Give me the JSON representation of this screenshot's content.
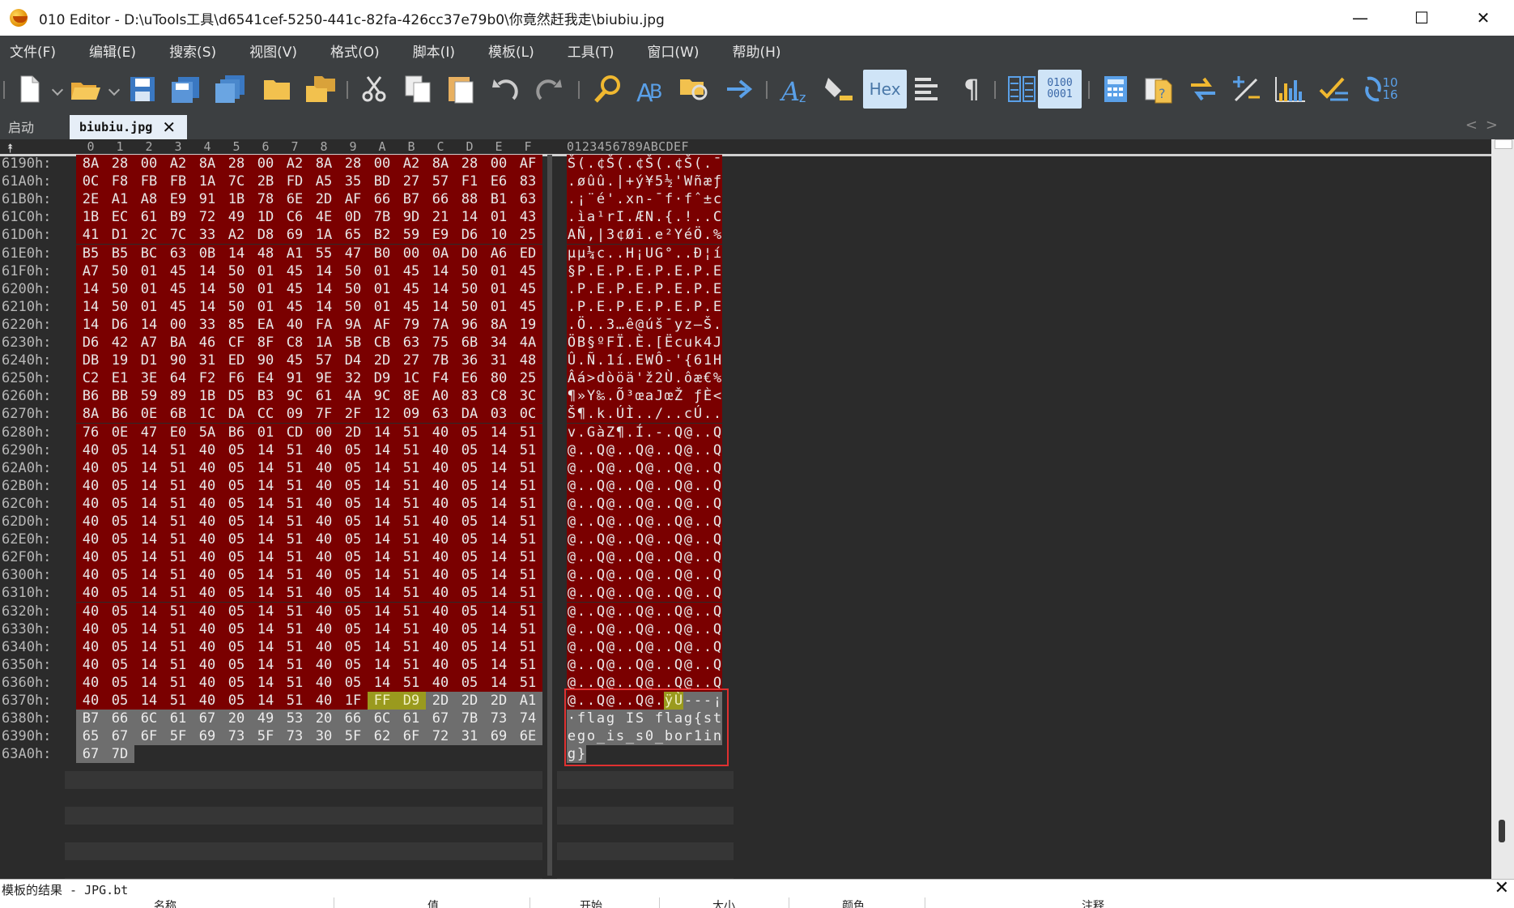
{
  "window": {
    "title": "010 Editor - D:\\uTools工具\\d6541cef-5250-441c-82fa-426cc37e79b0\\你竟然赶我走\\biubiu.jpg",
    "minimize": "—",
    "maximize": "☐",
    "close": "✕"
  },
  "menu": [
    "文件(F)",
    "编辑(E)",
    "搜索(S)",
    "视图(V)",
    "格式(O)",
    "脚本(I)",
    "模板(L)",
    "工具(T)",
    "窗口(W)",
    "帮助(H)"
  ],
  "toolbar": {
    "hex_label": "Hex",
    "binary_label": "0100\n0001",
    "base_label": "10\n16"
  },
  "tabs": {
    "start": "启动",
    "file": "biubiu.jpg",
    "close": "✕",
    "nav": "<>"
  },
  "hex_header": [
    "0",
    "1",
    "2",
    "3",
    "4",
    "5",
    "6",
    "7",
    "8",
    "9",
    "A",
    "B",
    "C",
    "D",
    "E",
    "F"
  ],
  "ascii_header": "0123456789ABCDEF",
  "rows": [
    {
      "addr": "6190h:",
      "bytes": [
        "8A",
        "28",
        "00",
        "A2",
        "8A",
        "28",
        "00",
        "A2",
        "8A",
        "28",
        "00",
        "A2",
        "8A",
        "28",
        "00",
        "AF"
      ],
      "ascii": "Š(.¢Š(.¢Š(.¢Š(.¯",
      "style": "rrrrrrrrrrrrrrrr"
    },
    {
      "addr": "61A0h:",
      "bytes": [
        "0C",
        "F8",
        "FB",
        "FB",
        "1A",
        "7C",
        "2B",
        "FD",
        "A5",
        "35",
        "BD",
        "27",
        "57",
        "F1",
        "E6",
        "83"
      ],
      "ascii": ".øûû.|+ý¥5½'Wñæƒ",
      "style": "rrrrrrrrrrrrrrrr"
    },
    {
      "addr": "61B0h:",
      "bytes": [
        "2E",
        "A1",
        "A8",
        "E9",
        "91",
        "1B",
        "78",
        "6E",
        "2D",
        "AF",
        "66",
        "B7",
        "66",
        "88",
        "B1",
        "63"
      ],
      "ascii": ".¡¨é'.xn-¯f·fˆ±c",
      "style": "rrrrrrrrrrrrrrrr"
    },
    {
      "addr": "61C0h:",
      "bytes": [
        "1B",
        "EC",
        "61",
        "B9",
        "72",
        "49",
        "1D",
        "C6",
        "4E",
        "0D",
        "7B",
        "9D",
        "21",
        "14",
        "01",
        "43"
      ],
      "ascii": ".ìa¹rI.ÆN.{.!..C",
      "style": "rrrrrrrrrrrrrrrr"
    },
    {
      "addr": "61D0h:",
      "bytes": [
        "41",
        "D1",
        "2C",
        "7C",
        "33",
        "A2",
        "D8",
        "69",
        "1A",
        "65",
        "B2",
        "59",
        "E9",
        "D6",
        "10",
        "25"
      ],
      "ascii": "AÑ,|3¢Øi.e²YéÖ.%",
      "style": "rrrrrrrrrrrrrrrr"
    },
    {
      "addr": "61E0h:",
      "bytes": [
        "B5",
        "B5",
        "BC",
        "63",
        "0B",
        "14",
        "48",
        "A1",
        "55",
        "47",
        "B0",
        "00",
        "0A",
        "D0",
        "A6",
        "ED"
      ],
      "ascii": "µµ¼c..H¡UG°..Ð¦í",
      "style": "rrrrrrrrrrrrrrrr"
    },
    {
      "addr": "61F0h:",
      "bytes": [
        "A7",
        "50",
        "01",
        "45",
        "14",
        "50",
        "01",
        "45",
        "14",
        "50",
        "01",
        "45",
        "14",
        "50",
        "01",
        "45"
      ],
      "ascii": "§P.E.P.E.P.E.P.E",
      "style": "rrrrrrrrrrrrrrrr"
    },
    {
      "addr": "6200h:",
      "bytes": [
        "14",
        "50",
        "01",
        "45",
        "14",
        "50",
        "01",
        "45",
        "14",
        "50",
        "01",
        "45",
        "14",
        "50",
        "01",
        "45"
      ],
      "ascii": ".P.E.P.E.P.E.P.E",
      "style": "rrrrrrrrrrrrrrrr"
    },
    {
      "addr": "6210h:",
      "bytes": [
        "14",
        "50",
        "01",
        "45",
        "14",
        "50",
        "01",
        "45",
        "14",
        "50",
        "01",
        "45",
        "14",
        "50",
        "01",
        "45"
      ],
      "ascii": ".P.E.P.E.P.E.P.E",
      "style": "rrrrrrrrrrrrrrrr"
    },
    {
      "addr": "6220h:",
      "bytes": [
        "14",
        "D6",
        "14",
        "00",
        "33",
        "85",
        "EA",
        "40",
        "FA",
        "9A",
        "AF",
        "79",
        "7A",
        "96",
        "8A",
        "19"
      ],
      "ascii": ".Ö..3…ê@úš¯yz–Š.",
      "style": "rrrrrrrrrrrrrrrr"
    },
    {
      "addr": "6230h:",
      "bytes": [
        "D6",
        "42",
        "A7",
        "BA",
        "46",
        "CF",
        "8F",
        "C8",
        "1A",
        "5B",
        "CB",
        "63",
        "75",
        "6B",
        "34",
        "4A"
      ],
      "ascii": "ÖB§ºFÏ.È.[Ëcuk4J",
      "style": "rrrrrrrrrrrrrrrr"
    },
    {
      "addr": "6240h:",
      "bytes": [
        "DB",
        "19",
        "D1",
        "90",
        "31",
        "ED",
        "90",
        "45",
        "57",
        "D4",
        "2D",
        "27",
        "7B",
        "36",
        "31",
        "48"
      ],
      "ascii": "Û.Ñ.1í.EWÔ-'{61H",
      "style": "rrrrrrrrrrrrrrrr"
    },
    {
      "addr": "6250h:",
      "bytes": [
        "C2",
        "E1",
        "3E",
        "64",
        "F2",
        "F6",
        "E4",
        "91",
        "9E",
        "32",
        "D9",
        "1C",
        "F4",
        "E6",
        "80",
        "25"
      ],
      "ascii": "Âá>dòöä'ž2Ù.ôæ€%",
      "style": "rrrrrrrrrrrrrrrr"
    },
    {
      "addr": "6260h:",
      "bytes": [
        "B6",
        "BB",
        "59",
        "89",
        "1B",
        "D5",
        "B3",
        "9C",
        "61",
        "4A",
        "9C",
        "8E",
        "A0",
        "83",
        "C8",
        "3C"
      ],
      "ascii": "¶»Y‰.Õ³œaJœŽ ƒÈ<",
      "style": "rrrrrrrrrrrrrrrr"
    },
    {
      "addr": "6270h:",
      "bytes": [
        "8A",
        "B6",
        "0E",
        "6B",
        "1C",
        "DA",
        "CC",
        "09",
        "7F",
        "2F",
        "12",
        "09",
        "63",
        "DA",
        "03",
        "0C"
      ],
      "ascii": "Š¶.k.ÚÌ../..cÚ..",
      "style": "rrrrrrrrrrrrrrrr"
    },
    {
      "addr": "6280h:",
      "bytes": [
        "76",
        "0E",
        "47",
        "E0",
        "5A",
        "B6",
        "01",
        "CD",
        "00",
        "2D",
        "14",
        "51",
        "40",
        "05",
        "14",
        "51"
      ],
      "ascii": "v.GàZ¶.Í.-.Q@..Q",
      "style": "rrrrrrrrrrrrrrrr"
    },
    {
      "addr": "6290h:",
      "bytes": [
        "40",
        "05",
        "14",
        "51",
        "40",
        "05",
        "14",
        "51",
        "40",
        "05",
        "14",
        "51",
        "40",
        "05",
        "14",
        "51"
      ],
      "ascii": "@..Q@..Q@..Q@..Q",
      "style": "rrrrrrrrrrrrrrrr"
    },
    {
      "addr": "62A0h:",
      "bytes": [
        "40",
        "05",
        "14",
        "51",
        "40",
        "05",
        "14",
        "51",
        "40",
        "05",
        "14",
        "51",
        "40",
        "05",
        "14",
        "51"
      ],
      "ascii": "@..Q@..Q@..Q@..Q",
      "style": "rrrrrrrrrrrrrrrr"
    },
    {
      "addr": "62B0h:",
      "bytes": [
        "40",
        "05",
        "14",
        "51",
        "40",
        "05",
        "14",
        "51",
        "40",
        "05",
        "14",
        "51",
        "40",
        "05",
        "14",
        "51"
      ],
      "ascii": "@..Q@..Q@..Q@..Q",
      "style": "rrrrrrrrrrrrrrrr"
    },
    {
      "addr": "62C0h:",
      "bytes": [
        "40",
        "05",
        "14",
        "51",
        "40",
        "05",
        "14",
        "51",
        "40",
        "05",
        "14",
        "51",
        "40",
        "05",
        "14",
        "51"
      ],
      "ascii": "@..Q@..Q@..Q@..Q",
      "style": "rrrrrrrrrrrrrrrr"
    },
    {
      "addr": "62D0h:",
      "bytes": [
        "40",
        "05",
        "14",
        "51",
        "40",
        "05",
        "14",
        "51",
        "40",
        "05",
        "14",
        "51",
        "40",
        "05",
        "14",
        "51"
      ],
      "ascii": "@..Q@..Q@..Q@..Q",
      "style": "rrrrrrrrrrrrrrrr"
    },
    {
      "addr": "62E0h:",
      "bytes": [
        "40",
        "05",
        "14",
        "51",
        "40",
        "05",
        "14",
        "51",
        "40",
        "05",
        "14",
        "51",
        "40",
        "05",
        "14",
        "51"
      ],
      "ascii": "@..Q@..Q@..Q@..Q",
      "style": "rrrrrrrrrrrrrrrr"
    },
    {
      "addr": "62F0h:",
      "bytes": [
        "40",
        "05",
        "14",
        "51",
        "40",
        "05",
        "14",
        "51",
        "40",
        "05",
        "14",
        "51",
        "40",
        "05",
        "14",
        "51"
      ],
      "ascii": "@..Q@..Q@..Q@..Q",
      "style": "rrrrrrrrrrrrrrrr"
    },
    {
      "addr": "6300h:",
      "bytes": [
        "40",
        "05",
        "14",
        "51",
        "40",
        "05",
        "14",
        "51",
        "40",
        "05",
        "14",
        "51",
        "40",
        "05",
        "14",
        "51"
      ],
      "ascii": "@..Q@..Q@..Q@..Q",
      "style": "rrrrrrrrrrrrrrrr"
    },
    {
      "addr": "6310h:",
      "bytes": [
        "40",
        "05",
        "14",
        "51",
        "40",
        "05",
        "14",
        "51",
        "40",
        "05",
        "14",
        "51",
        "40",
        "05",
        "14",
        "51"
      ],
      "ascii": "@..Q@..Q@..Q@..Q",
      "style": "rrrrrrrrrrrrrrrr"
    },
    {
      "addr": "6320h:",
      "bytes": [
        "40",
        "05",
        "14",
        "51",
        "40",
        "05",
        "14",
        "51",
        "40",
        "05",
        "14",
        "51",
        "40",
        "05",
        "14",
        "51"
      ],
      "ascii": "@..Q@..Q@..Q@..Q",
      "style": "rrrrrrrrrrrrrrrr"
    },
    {
      "addr": "6330h:",
      "bytes": [
        "40",
        "05",
        "14",
        "51",
        "40",
        "05",
        "14",
        "51",
        "40",
        "05",
        "14",
        "51",
        "40",
        "05",
        "14",
        "51"
      ],
      "ascii": "@..Q@..Q@..Q@..Q",
      "style": "rrrrrrrrrrrrrrrr"
    },
    {
      "addr": "6340h:",
      "bytes": [
        "40",
        "05",
        "14",
        "51",
        "40",
        "05",
        "14",
        "51",
        "40",
        "05",
        "14",
        "51",
        "40",
        "05",
        "14",
        "51"
      ],
      "ascii": "@..Q@..Q@..Q@..Q",
      "style": "rrrrrrrrrrrrrrrr"
    },
    {
      "addr": "6350h:",
      "bytes": [
        "40",
        "05",
        "14",
        "51",
        "40",
        "05",
        "14",
        "51",
        "40",
        "05",
        "14",
        "51",
        "40",
        "05",
        "14",
        "51"
      ],
      "ascii": "@..Q@..Q@..Q@..Q",
      "style": "rrrrrrrrrrrrrrrr"
    },
    {
      "addr": "6360h:",
      "bytes": [
        "40",
        "05",
        "14",
        "51",
        "40",
        "05",
        "14",
        "51",
        "40",
        "05",
        "14",
        "51",
        "40",
        "05",
        "14",
        "51"
      ],
      "ascii": "@..Q@..Q@..Q@..Q",
      "style": "rrrrrrrrrrrrrrrr"
    },
    {
      "addr": "6370h:",
      "bytes": [
        "40",
        "05",
        "14",
        "51",
        "40",
        "05",
        "14",
        "51",
        "40",
        "1F",
        "FF",
        "D9",
        "2D",
        "2D",
        "2D",
        "A1"
      ],
      "ascii": "@..Q@..Q@.ÿÙ---¡",
      "style": "rrrrrrrrrryygggg"
    },
    {
      "addr": "6380h:",
      "bytes": [
        "B7",
        "66",
        "6C",
        "61",
        "67",
        "20",
        "49",
        "53",
        "20",
        "66",
        "6C",
        "61",
        "67",
        "7B",
        "73",
        "74"
      ],
      "ascii": "·flag IS flag{st",
      "style": "gggggggggggggggg"
    },
    {
      "addr": "6390h:",
      "bytes": [
        "65",
        "67",
        "6F",
        "5F",
        "69",
        "73",
        "5F",
        "73",
        "30",
        "5F",
        "62",
        "6F",
        "72",
        "31",
        "69",
        "6E"
      ],
      "ascii": "ego_is_s0_bor1in",
      "style": "gggggggggggggggg"
    },
    {
      "addr": "63A0h:",
      "bytes": [
        "67",
        "7D"
      ],
      "ascii": "g}",
      "style": "gg"
    }
  ],
  "bottom_panel": {
    "title": "模板的结果 - JPG.bt",
    "close": "✕",
    "columns": [
      "名称",
      "值",
      "开始",
      "大小",
      "颜色",
      "注释"
    ]
  }
}
